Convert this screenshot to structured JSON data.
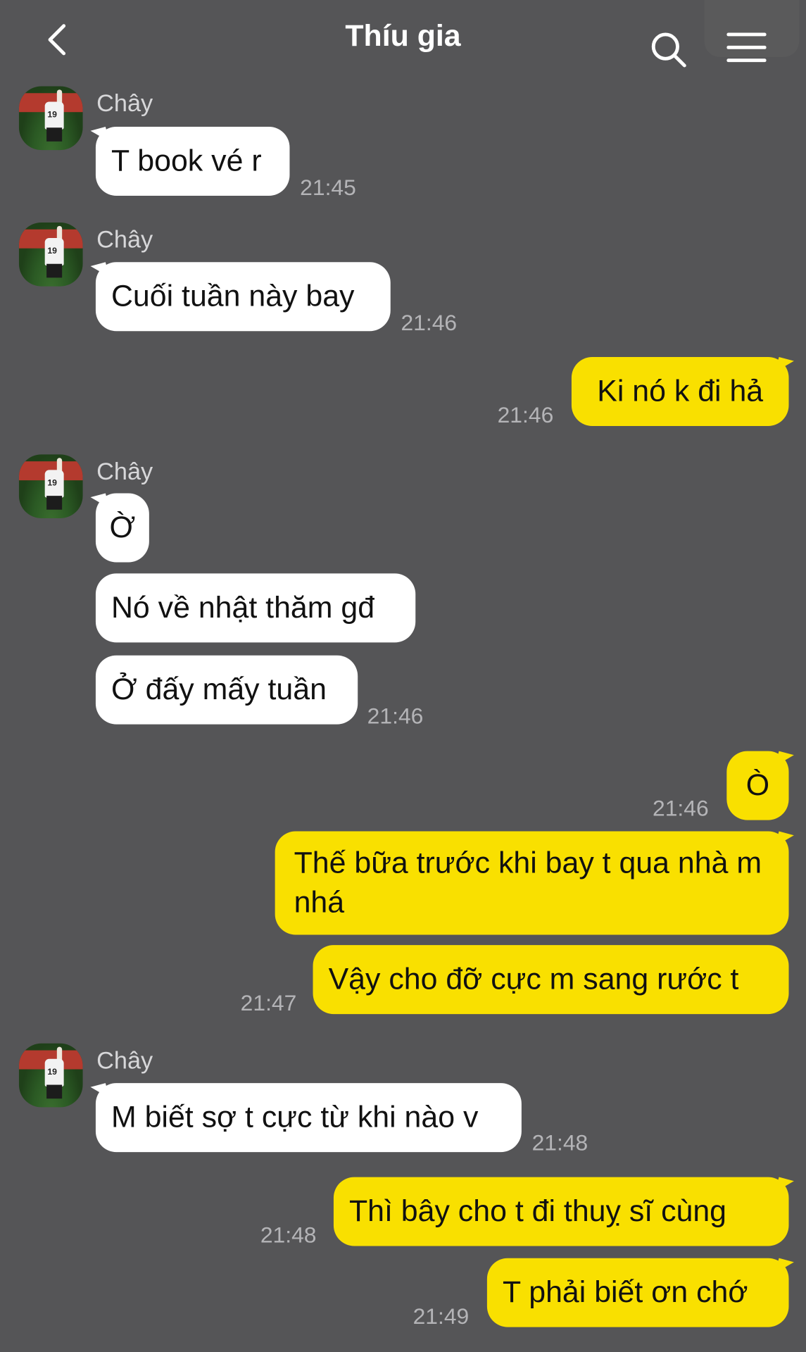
{
  "header": {
    "title": "Thíu gia"
  },
  "contact": {
    "name": "Chây"
  },
  "messages": [
    {
      "side": "in",
      "text": "T book vé r",
      "time": "21:45"
    },
    {
      "side": "in",
      "text": "Cuối tuần này bay",
      "time": "21:46"
    },
    {
      "side": "out",
      "text": "Ki nó k đi hả",
      "time": "21:46"
    },
    {
      "side": "in",
      "text": "Ờ"
    },
    {
      "side": "in",
      "text": "Nó về nhật thăm gđ"
    },
    {
      "side": "in",
      "text": "Ở đấy mấy tuần",
      "time": "21:46"
    },
    {
      "side": "out",
      "text": "Ò",
      "time": "21:46"
    },
    {
      "side": "out",
      "text": "Thế bữa trước khi bay t qua nhà m nhá"
    },
    {
      "side": "out",
      "text": "Vậy cho đỡ cực m sang rước t",
      "time": "21:47"
    },
    {
      "side": "in",
      "text": "M biết sợ t cực từ khi nào v",
      "time": "21:48"
    },
    {
      "side": "out",
      "text": "Thì bây cho t đi thuỵ sĩ cùng",
      "time": "21:48"
    },
    {
      "side": "out",
      "text": "T phải biết ơn chớ",
      "time": "21:49"
    }
  ],
  "colors": {
    "background": "#555557",
    "outgoing_bubble": "#f9e000",
    "incoming_bubble": "#ffffff"
  },
  "icons": [
    "back-arrow-icon",
    "search-icon",
    "menu-icon"
  ]
}
